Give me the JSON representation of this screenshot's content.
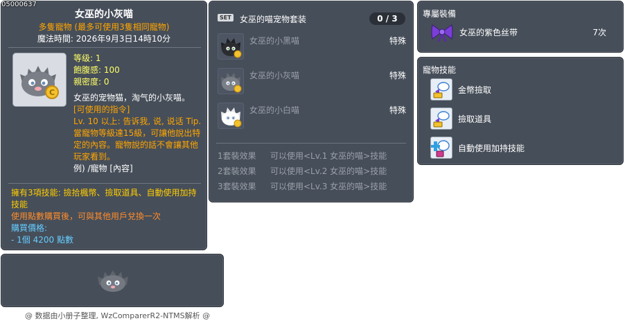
{
  "item_code": "05000637",
  "main": {
    "title": "女巫的小灰喵",
    "subtitle": "多隻寵物 (最多可使用3隻相同寵物)",
    "magic_time": "魔法時間: 2026年9月3日14時10分",
    "stats": [
      "等级: 1",
      "飽腹感: 100",
      "親密度: 0"
    ],
    "description": "女巫的宠物猫，淘气的小灰喵。",
    "commands_header": "[可使用的指令]",
    "commands_body": "Lv. 10 以上: 告诉我, 说, 说话 Tip. 當寵物等級達15級，可讓他說出特定的內容。寵物說的話不會讓其他玩家看到。",
    "commands_extra": "例) /寵物 [內容]",
    "skills_line": "擁有3項技能: 撿拾楓幣、撿取道具、自動使用加持技能",
    "exchange_line": "使用點數購買後，可與其他用戶兌換一次",
    "price_label": "購買價格:",
    "price_value": " - 1個 4200 點數"
  },
  "footer": "@ 数据由小册子整理, WzComparerR2-NTMS解析 @",
  "set": {
    "badge": "SET",
    "title": "女巫的喵宠物套装",
    "count": "0 / 3",
    "items": [
      {
        "name": "女巫的小黑喵",
        "tag": "特殊",
        "icon": "black-cat-icon"
      },
      {
        "name": "女巫的小灰喵",
        "tag": "特殊",
        "icon": "gray-cat-icon"
      },
      {
        "name": "女巫的小白喵",
        "tag": "特殊",
        "icon": "white-cat-icon"
      }
    ],
    "effects": [
      {
        "label": "1套裝效果",
        "text": "可以使用<Lv.1 女巫的喵>技能"
      },
      {
        "label": "2套裝效果",
        "text": "可以使用<Lv.2 女巫的喵>技能"
      },
      {
        "label": "3套裝效果",
        "text": "可以使用<Lv.3 女巫的喵>技能"
      }
    ]
  },
  "exclusive": {
    "title": "專屬裝備",
    "item_name": "女巫的紫色丝带",
    "item_count": "7次",
    "icon": "purple-ribbon-icon"
  },
  "skills": {
    "title": "寵物技能",
    "items": [
      {
        "name": "金幣撿取",
        "icon": "meso-pickup-icon"
      },
      {
        "name": "撿取道具",
        "icon": "item-pickup-icon"
      },
      {
        "name": "自動使用加持技能",
        "icon": "auto-buff-icon"
      }
    ]
  }
}
